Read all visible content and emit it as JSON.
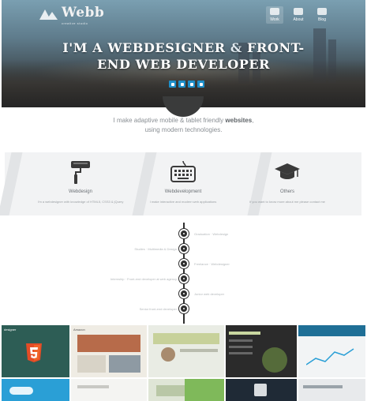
{
  "hero": {
    "logo_text": "Webb",
    "logo_sub": "creative studio",
    "nav": [
      {
        "label": "Work",
        "active": true
      },
      {
        "label": "About",
        "active": false
      },
      {
        "label": "Blog",
        "active": false
      }
    ],
    "headline_line1_a": "I'M A WEBDESIGNER ",
    "headline_amp": "&",
    "headline_line1_b": " FRONT-",
    "headline_line2": "END WEB DEVELOPER",
    "social_icons": [
      "twitter-icon",
      "facebook-icon",
      "dribbble-icon",
      "linkedin-icon"
    ],
    "accent_color": "#1d8fc9"
  },
  "intro": {
    "line1_pre": "I make adaptive mobile & tablet friendly ",
    "line1_bold": "websites",
    "line1_post": ",",
    "line2": "using modern technologies."
  },
  "services": [
    {
      "icon": "paint-roller-icon",
      "title": "Webdesign",
      "desc": "I'm a webdesigner with knowledge of HTML5, CSS3 & jQuery"
    },
    {
      "icon": "keyboard-icon",
      "title": "Webdevelopment",
      "desc": "I make interactive and modern web applications"
    },
    {
      "icon": "graduation-cap-icon",
      "title": "Others",
      "desc": "If you want to know more about me please contact me"
    }
  ],
  "timeline": [
    {
      "side": "right",
      "text": "Graduation · Webdesign"
    },
    {
      "side": "left",
      "text": "Studies · Multimedia & Design"
    },
    {
      "side": "right",
      "text": "Freelance · Webdesigner"
    },
    {
      "side": "left",
      "text": "Internship · Front-end developer at web agency"
    },
    {
      "side": "right",
      "text": "Junior web developer"
    },
    {
      "side": "left",
      "text": "Senior front-end developer"
    }
  ],
  "thumbnails": [
    {
      "label": "designer",
      "bg": "#2d5d55"
    },
    {
      "label": "Amazon",
      "bg": "#efece4"
    },
    {
      "label": "",
      "bg": "#e9ece4"
    },
    {
      "label": "",
      "bg": "#c9d6a8"
    },
    {
      "label": "",
      "bg": "#2b2b2b"
    },
    {
      "label": "",
      "bg": "#1f6f96"
    },
    {
      "label": "",
      "bg": "#2a9fd6"
    },
    {
      "label": "",
      "bg": "#f4f4f2"
    },
    {
      "label": "",
      "bg": "#dfe5d6"
    },
    {
      "label": "",
      "bg": "#7fb95a"
    },
    {
      "label": "",
      "bg": "#1f2a36"
    },
    {
      "label": "",
      "bg": "#e8eaec"
    }
  ]
}
